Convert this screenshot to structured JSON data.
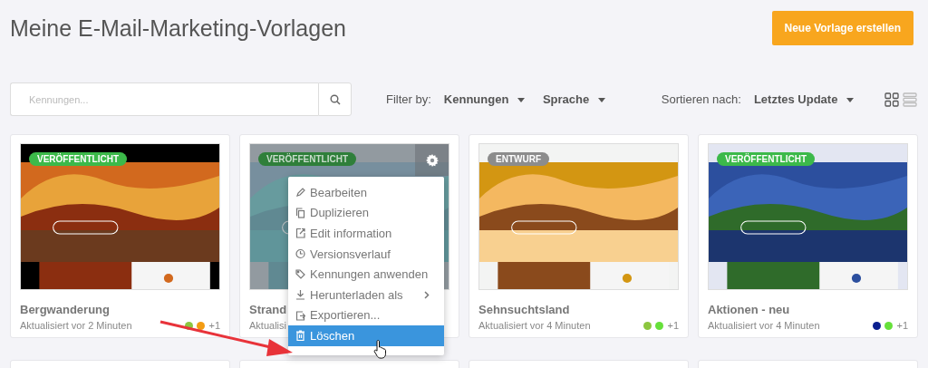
{
  "title": "Meine E-Mail-Marketing-Vorlagen",
  "new_button": "Neue Vorlage erstellen",
  "search": {
    "placeholder": "Kennungen..."
  },
  "filter": {
    "label": "Filter by:",
    "options": [
      "Kennungen",
      "Sprache"
    ]
  },
  "sort": {
    "label": "Sortieren nach:",
    "value": "Letztes Update"
  },
  "view_modes": [
    {
      "kind": "grid",
      "selected": true
    },
    {
      "kind": "list",
      "selected": false
    }
  ],
  "cards": [
    {
      "status": {
        "kind": "published",
        "label": "VERÖFFENTLICHT"
      },
      "name": "Bergwanderung",
      "updated": "Aktualisiert vor 2 Minuten",
      "tags": [
        {
          "color": "#8cc63f"
        },
        {
          "color": "#f39c12"
        }
      ],
      "more": "+1",
      "menu_open": false
    },
    {
      "status": {
        "kind": "published",
        "label": "VERÖFFENTLICHT"
      },
      "name": "Strand",
      "updated": "Aktualisi",
      "menu_open": true
    },
    {
      "status": {
        "kind": "draft",
        "label": "ENTWURF"
      },
      "name": "Sehnsuchtsland",
      "updated": "Aktualisiert vor 4 Minuten",
      "tags": [
        {
          "color": "#8cc63f"
        },
        {
          "color": "#66e03a"
        }
      ],
      "more": "+1",
      "menu_open": false
    },
    {
      "status": {
        "kind": "published",
        "label": "VERÖFFENTLICHT"
      },
      "name": "Aktionen - neu",
      "updated": "Aktualisiert vor 4 Minuten",
      "tags": [
        {
          "color": "#0a1f8f"
        },
        {
          "color": "#66e03a"
        }
      ],
      "more": "+1",
      "menu_open": false
    }
  ],
  "context_menu": [
    {
      "kind": "edit",
      "label": "Bearbeiten",
      "selected": false
    },
    {
      "kind": "copy",
      "label": "Duplizieren",
      "selected": false
    },
    {
      "kind": "info",
      "label": "Edit information",
      "selected": false
    },
    {
      "kind": "history",
      "label": "Versionsverlauf",
      "selected": false
    },
    {
      "kind": "tag",
      "label": "Kennungen anwenden",
      "selected": false
    },
    {
      "kind": "download",
      "label": "Herunterladen als",
      "selected": false,
      "submenu": true
    },
    {
      "kind": "export",
      "label": "Exportieren...",
      "selected": false
    },
    {
      "kind": "delete",
      "label": "Löschen",
      "selected": true
    }
  ]
}
